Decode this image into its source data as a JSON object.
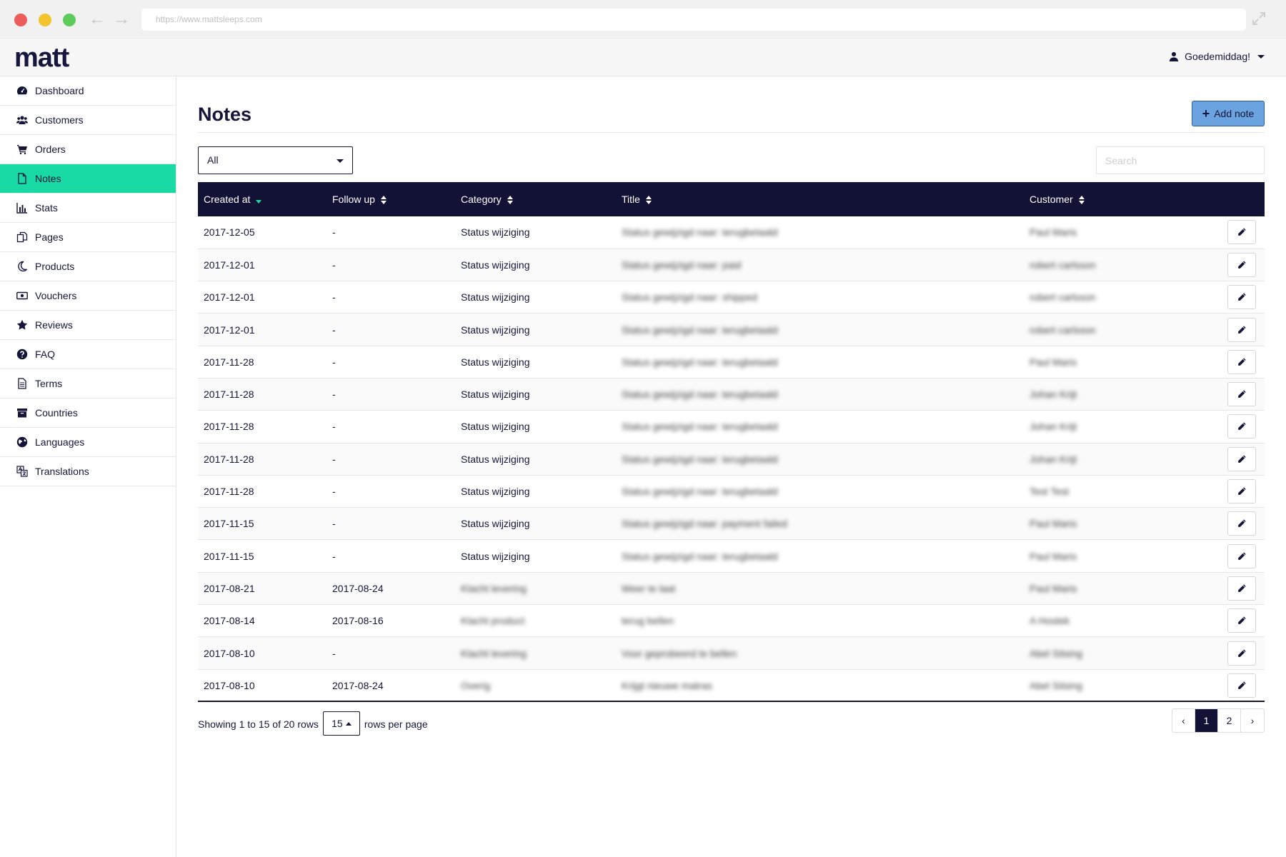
{
  "browser": {
    "url": "https://www.mattsleeps.com"
  },
  "header": {
    "logo": "matt",
    "greeting": "Goedemiddag!"
  },
  "sidebar": {
    "items": [
      {
        "label": "Dashboard",
        "icon": "dashboard-icon"
      },
      {
        "label": "Customers",
        "icon": "users-icon"
      },
      {
        "label": "Orders",
        "icon": "cart-icon"
      },
      {
        "label": "Notes",
        "icon": "file-icon",
        "active": true
      },
      {
        "label": "Stats",
        "icon": "bar-chart-icon"
      },
      {
        "label": "Pages",
        "icon": "copy-icon"
      },
      {
        "label": "Products",
        "icon": "moon-icon"
      },
      {
        "label": "Vouchers",
        "icon": "money-icon"
      },
      {
        "label": "Reviews",
        "icon": "star-icon"
      },
      {
        "label": "FAQ",
        "icon": "question-icon"
      },
      {
        "label": "Terms",
        "icon": "document-icon"
      },
      {
        "label": "Countries",
        "icon": "archive-icon"
      },
      {
        "label": "Languages",
        "icon": "globe-icon"
      },
      {
        "label": "Translations",
        "icon": "translate-icon"
      }
    ]
  },
  "main": {
    "title": "Notes",
    "add_button": "Add note",
    "filter": {
      "selected": "All"
    },
    "search": {
      "placeholder": "Search"
    },
    "table": {
      "columns": [
        "Created at",
        "Follow up",
        "Category",
        "Title",
        "Customer"
      ],
      "rows": [
        {
          "created": "2017-12-05",
          "follow": "-",
          "category": "Status wijziging",
          "title": "Status gewijzigd naar: terugbetaald",
          "customer": "Paul Maris"
        },
        {
          "created": "2017-12-01",
          "follow": "-",
          "category": "Status wijziging",
          "title": "Status gewijzigd naar: paid",
          "customer": "robert carlsson"
        },
        {
          "created": "2017-12-01",
          "follow": "-",
          "category": "Status wijziging",
          "title": "Status gewijzigd naar: shipped",
          "customer": "robert carlsson"
        },
        {
          "created": "2017-12-01",
          "follow": "-",
          "category": "Status wijziging",
          "title": "Status gewijzigd naar: terugbetaald",
          "customer": "robert carlsson"
        },
        {
          "created": "2017-11-28",
          "follow": "-",
          "category": "Status wijziging",
          "title": "Status gewijzigd naar: terugbetaald",
          "customer": "Paul Maris"
        },
        {
          "created": "2017-11-28",
          "follow": "-",
          "category": "Status wijziging",
          "title": "Status gewijzigd naar: terugbetaald",
          "customer": "Johan Krijt"
        },
        {
          "created": "2017-11-28",
          "follow": "-",
          "category": "Status wijziging",
          "title": "Status gewijzigd naar: terugbetaald",
          "customer": "Johan Krijt"
        },
        {
          "created": "2017-11-28",
          "follow": "-",
          "category": "Status wijziging",
          "title": "Status gewijzigd naar: terugbetaald",
          "customer": "Johan Krijt"
        },
        {
          "created": "2017-11-28",
          "follow": "-",
          "category": "Status wijziging",
          "title": "Status gewijzigd naar: terugbetaald",
          "customer": "Test Test"
        },
        {
          "created": "2017-11-15",
          "follow": "-",
          "category": "Status wijziging",
          "title": "Status gewijzigd naar: payment failed",
          "customer": "Paul Maris"
        },
        {
          "created": "2017-11-15",
          "follow": "-",
          "category": "Status wijziging",
          "title": "Status gewijzigd naar: terugbetaald",
          "customer": "Paul Maris"
        },
        {
          "created": "2017-08-21",
          "follow": "2017-08-24",
          "category": "Klacht levering",
          "title": "Weer te laat",
          "customer": "Paul Maris"
        },
        {
          "created": "2017-08-14",
          "follow": "2017-08-16",
          "category": "Klacht product",
          "title": "terug bellen",
          "customer": "A Hostek"
        },
        {
          "created": "2017-08-10",
          "follow": "-",
          "category": "Klacht levering",
          "title": "Voor geprobeerd te bellen",
          "customer": "Abel Sitsing"
        },
        {
          "created": "2017-08-10",
          "follow": "2017-08-24",
          "category": "Overig",
          "title": "Krijgt nieuwe matras",
          "customer": "Abel Sitsing"
        }
      ]
    },
    "footer": {
      "showing": "Showing 1 to 15 of 20 rows",
      "per_page": "15",
      "per_page_suffix": "rows per page",
      "pages": [
        "‹",
        "1",
        "2",
        "›"
      ],
      "current_page": "1"
    }
  },
  "colors": {
    "accent": "#19d9a5",
    "navy": "#121236",
    "button": "#6aa3e0"
  }
}
